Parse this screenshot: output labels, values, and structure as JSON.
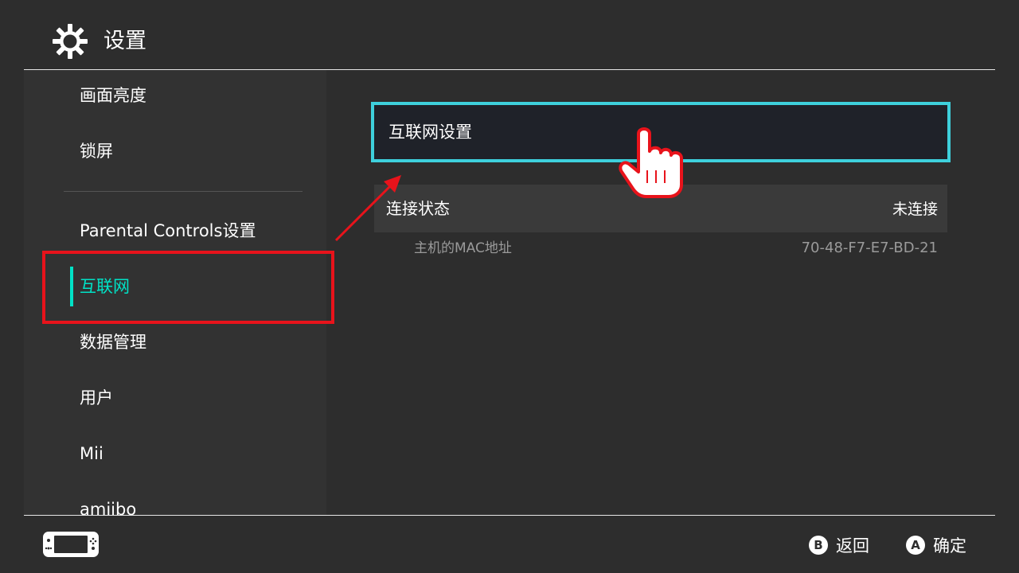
{
  "header": {
    "title": "设置",
    "icon": "gear-icon"
  },
  "sidebar": {
    "items": [
      {
        "label": "画面亮度"
      },
      {
        "label": "锁屏"
      },
      {
        "label": "Parental Controls设置"
      },
      {
        "label": "互联网",
        "active": true
      },
      {
        "label": "数据管理"
      },
      {
        "label": "用户"
      },
      {
        "label": "Mii"
      },
      {
        "label": "amiibo"
      }
    ]
  },
  "main": {
    "internet_settings": "互联网设置",
    "connection_status_label": "连接状态",
    "connection_status_value": "未连接",
    "mac_label": "主机的MAC地址",
    "mac_value": "70-48-F7-E7-BD-21"
  },
  "footer": {
    "back_key": "B",
    "back_label": "返回",
    "ok_key": "A",
    "ok_label": "确定"
  },
  "colors": {
    "background": "#2d2d2d",
    "accent": "#00e2c6",
    "selection_border": "#3ed0dc",
    "annotation_red": "#e8131b"
  }
}
